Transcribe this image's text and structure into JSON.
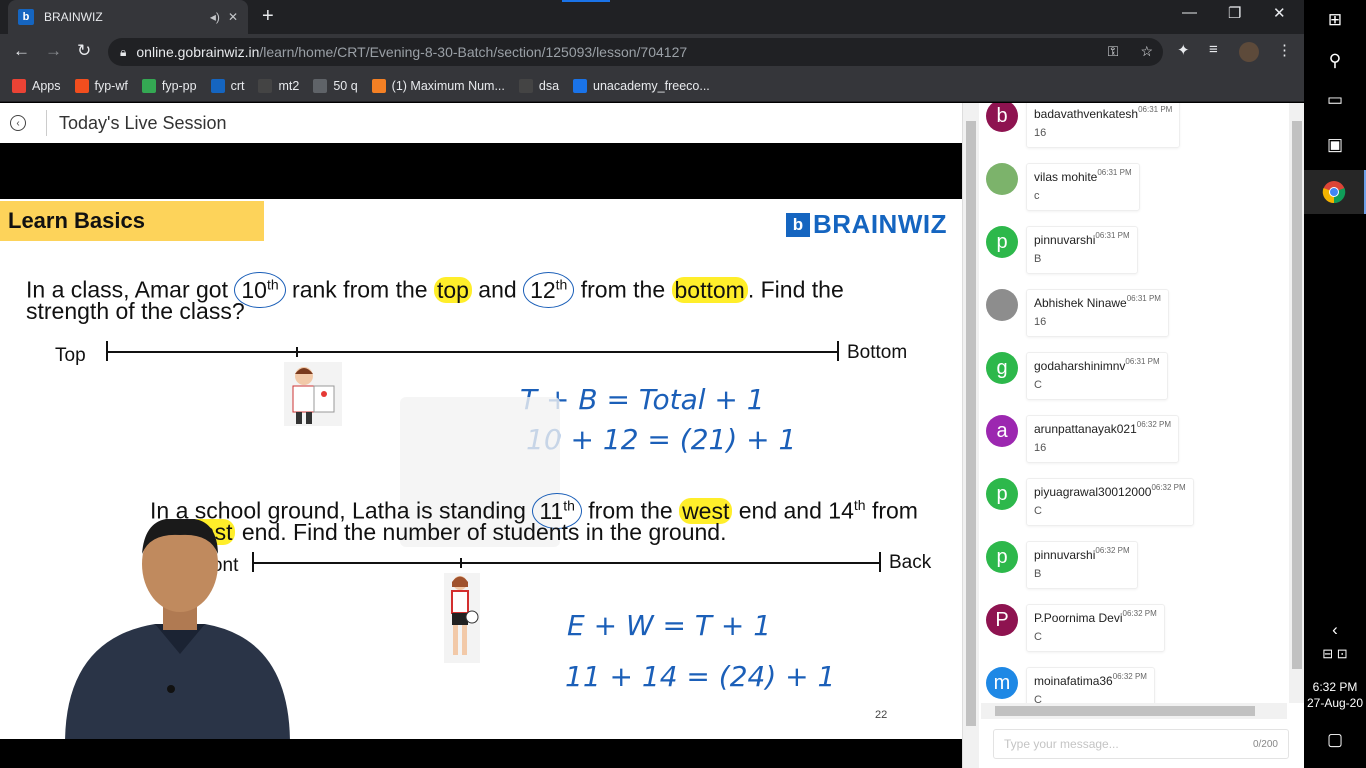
{
  "browser": {
    "tab_title": "BRAINWIZ",
    "tab_favicon": "b",
    "url_host": "online.gobrainwiz.in",
    "url_path": "/learn/home/CRT/Evening-8-30-Batch/section/125093/lesson/704127"
  },
  "bookmarks": [
    {
      "label": "Apps",
      "icon": "apps-grid-icon",
      "color": "#ea4335"
    },
    {
      "label": "fyp-wf",
      "icon": "figma-icon",
      "color": "#f24e1e"
    },
    {
      "label": "fyp-pp",
      "icon": "pd-icon",
      "color": "#34a853"
    },
    {
      "label": "crt",
      "icon": "brainwiz-icon",
      "color": "#1565c0"
    },
    {
      "label": "mt2",
      "icon": "cc-icon",
      "color": "#444444"
    },
    {
      "label": "50 q",
      "icon": "globe-icon",
      "color": "#5f6368"
    },
    {
      "label": "(1) Maximum Num...",
      "icon": "stackoverflow-icon",
      "color": "#f48024"
    },
    {
      "label": "dsa",
      "icon": "cc-icon",
      "color": "#444444"
    },
    {
      "label": "unacademy_freeco...",
      "icon": "unacademy-icon",
      "color": "#1a73e8"
    }
  ],
  "session": {
    "title": "Today's Live Session"
  },
  "slide": {
    "heading": "Learn Basics",
    "logo_text": "BRAINWIZ",
    "q1": {
      "p1": "In a class, Amar got ",
      "rank1": "10",
      "sup1": "th",
      "p2": " rank from the ",
      "top": "top",
      "p3": " and ",
      "rank2": "12",
      "sup2": "th",
      "p4": " from the ",
      "bottom": "bottom",
      "p5": ". Find the",
      "line2": "strength of the class?"
    },
    "line1": {
      "left": "Top",
      "right": "Bottom"
    },
    "hand1": {
      "l1": "T + B = Total + 1",
      "l2": "10 + 12 = (21) + 1"
    },
    "q2": {
      "p1": "In a school ground, Latha is standing ",
      "rank1": "11",
      "sup1": "th",
      "p2": " from the ",
      "west": "west",
      "p3": " end and 14",
      "sup2": "th",
      "p4": " from",
      "east": "east",
      "line2": " end. Find the number of students in the ground."
    },
    "line2": {
      "left": "Front",
      "right": "Back"
    },
    "hand2": {
      "l1": "E + W = T + 1",
      "l2": "11 + 14 = (24) + 1"
    },
    "page_number": "22"
  },
  "chat": {
    "messages": [
      {
        "initial": "b",
        "color": "#8e1350",
        "name": "badavathvenkatesh",
        "time": "06:31 PM",
        "text": "16"
      },
      {
        "initial": "",
        "color": "#7cb36b",
        "name": "vilas mohite",
        "time": "06:31 PM",
        "text": "c"
      },
      {
        "initial": "p",
        "color": "#2db84b",
        "name": "pinnuvarshi",
        "time": "06:31 PM",
        "text": "B"
      },
      {
        "initial": "",
        "color": "#8d8d8d",
        "name": "Abhishek Ninawe",
        "time": "06:31 PM",
        "text": "16"
      },
      {
        "initial": "g",
        "color": "#2db84b",
        "name": "godaharshinimnv",
        "time": "06:31 PM",
        "text": "C"
      },
      {
        "initial": "a",
        "color": "#9c27b0",
        "name": "arunpattanayak021",
        "time": "06:32 PM",
        "text": "16"
      },
      {
        "initial": "p",
        "color": "#2db84b",
        "name": "piyuagrawal30012000",
        "time": "06:32 PM",
        "text": "C"
      },
      {
        "initial": "p",
        "color": "#2db84b",
        "name": "pinnuvarshi",
        "time": "06:32 PM",
        "text": "B"
      },
      {
        "initial": "P",
        "color": "#8e1350",
        "name": "P.Poornima Devi",
        "time": "06:32 PM",
        "text": "C"
      },
      {
        "initial": "m",
        "color": "#1e88e5",
        "name": "moinafatima36",
        "time": "06:32 PM",
        "text": "C"
      }
    ],
    "input_placeholder": "Type your message...",
    "char_count": "0/200"
  },
  "taskbar": {
    "time": "6:32 PM",
    "date": "27-Aug-20"
  }
}
